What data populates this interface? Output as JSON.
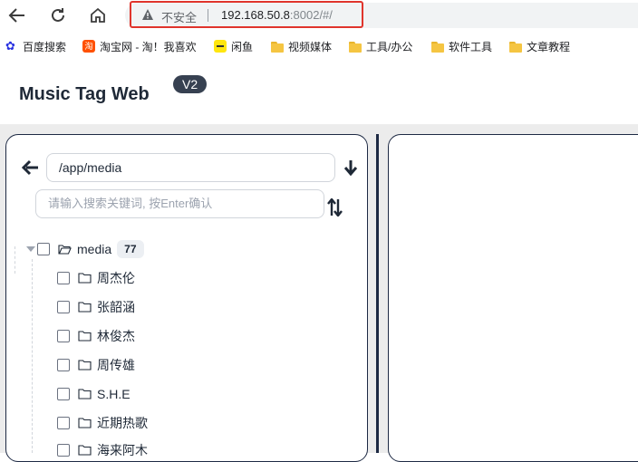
{
  "browser": {
    "security_label": "不安全",
    "url_host": "192.168.50.8",
    "url_rest": ":8002/#/"
  },
  "bookmarks": [
    {
      "label": "百度搜索",
      "icon": "baidu-icon"
    },
    {
      "label": "淘宝网 - 淘！我喜欢",
      "icon": "taobao-icon"
    },
    {
      "label": "闲鱼",
      "icon": "xianyu-icon"
    },
    {
      "label": "视频媒体",
      "icon": "folder-icon"
    },
    {
      "label": "工具/办公",
      "icon": "folder-icon"
    },
    {
      "label": "软件工具",
      "icon": "folder-icon"
    },
    {
      "label": "文章教程",
      "icon": "folder-icon"
    }
  ],
  "app": {
    "title": "Music Tag Web",
    "version": "V2"
  },
  "browser_panel": {
    "path": "/app/media",
    "search_placeholder": "请输入搜索关键词, 按Enter确认"
  },
  "tree": {
    "root": {
      "label": "media",
      "count": "77"
    },
    "children": [
      {
        "label": "周杰伦"
      },
      {
        "label": "张韶涵"
      },
      {
        "label": "林俊杰"
      },
      {
        "label": "周传雄"
      },
      {
        "label": "S.H.E"
      },
      {
        "label": "近期热歌"
      },
      {
        "label": "海来阿木"
      }
    ]
  },
  "colors": {
    "accent": "#1e2a44",
    "warning_outline": "#e0342c"
  }
}
